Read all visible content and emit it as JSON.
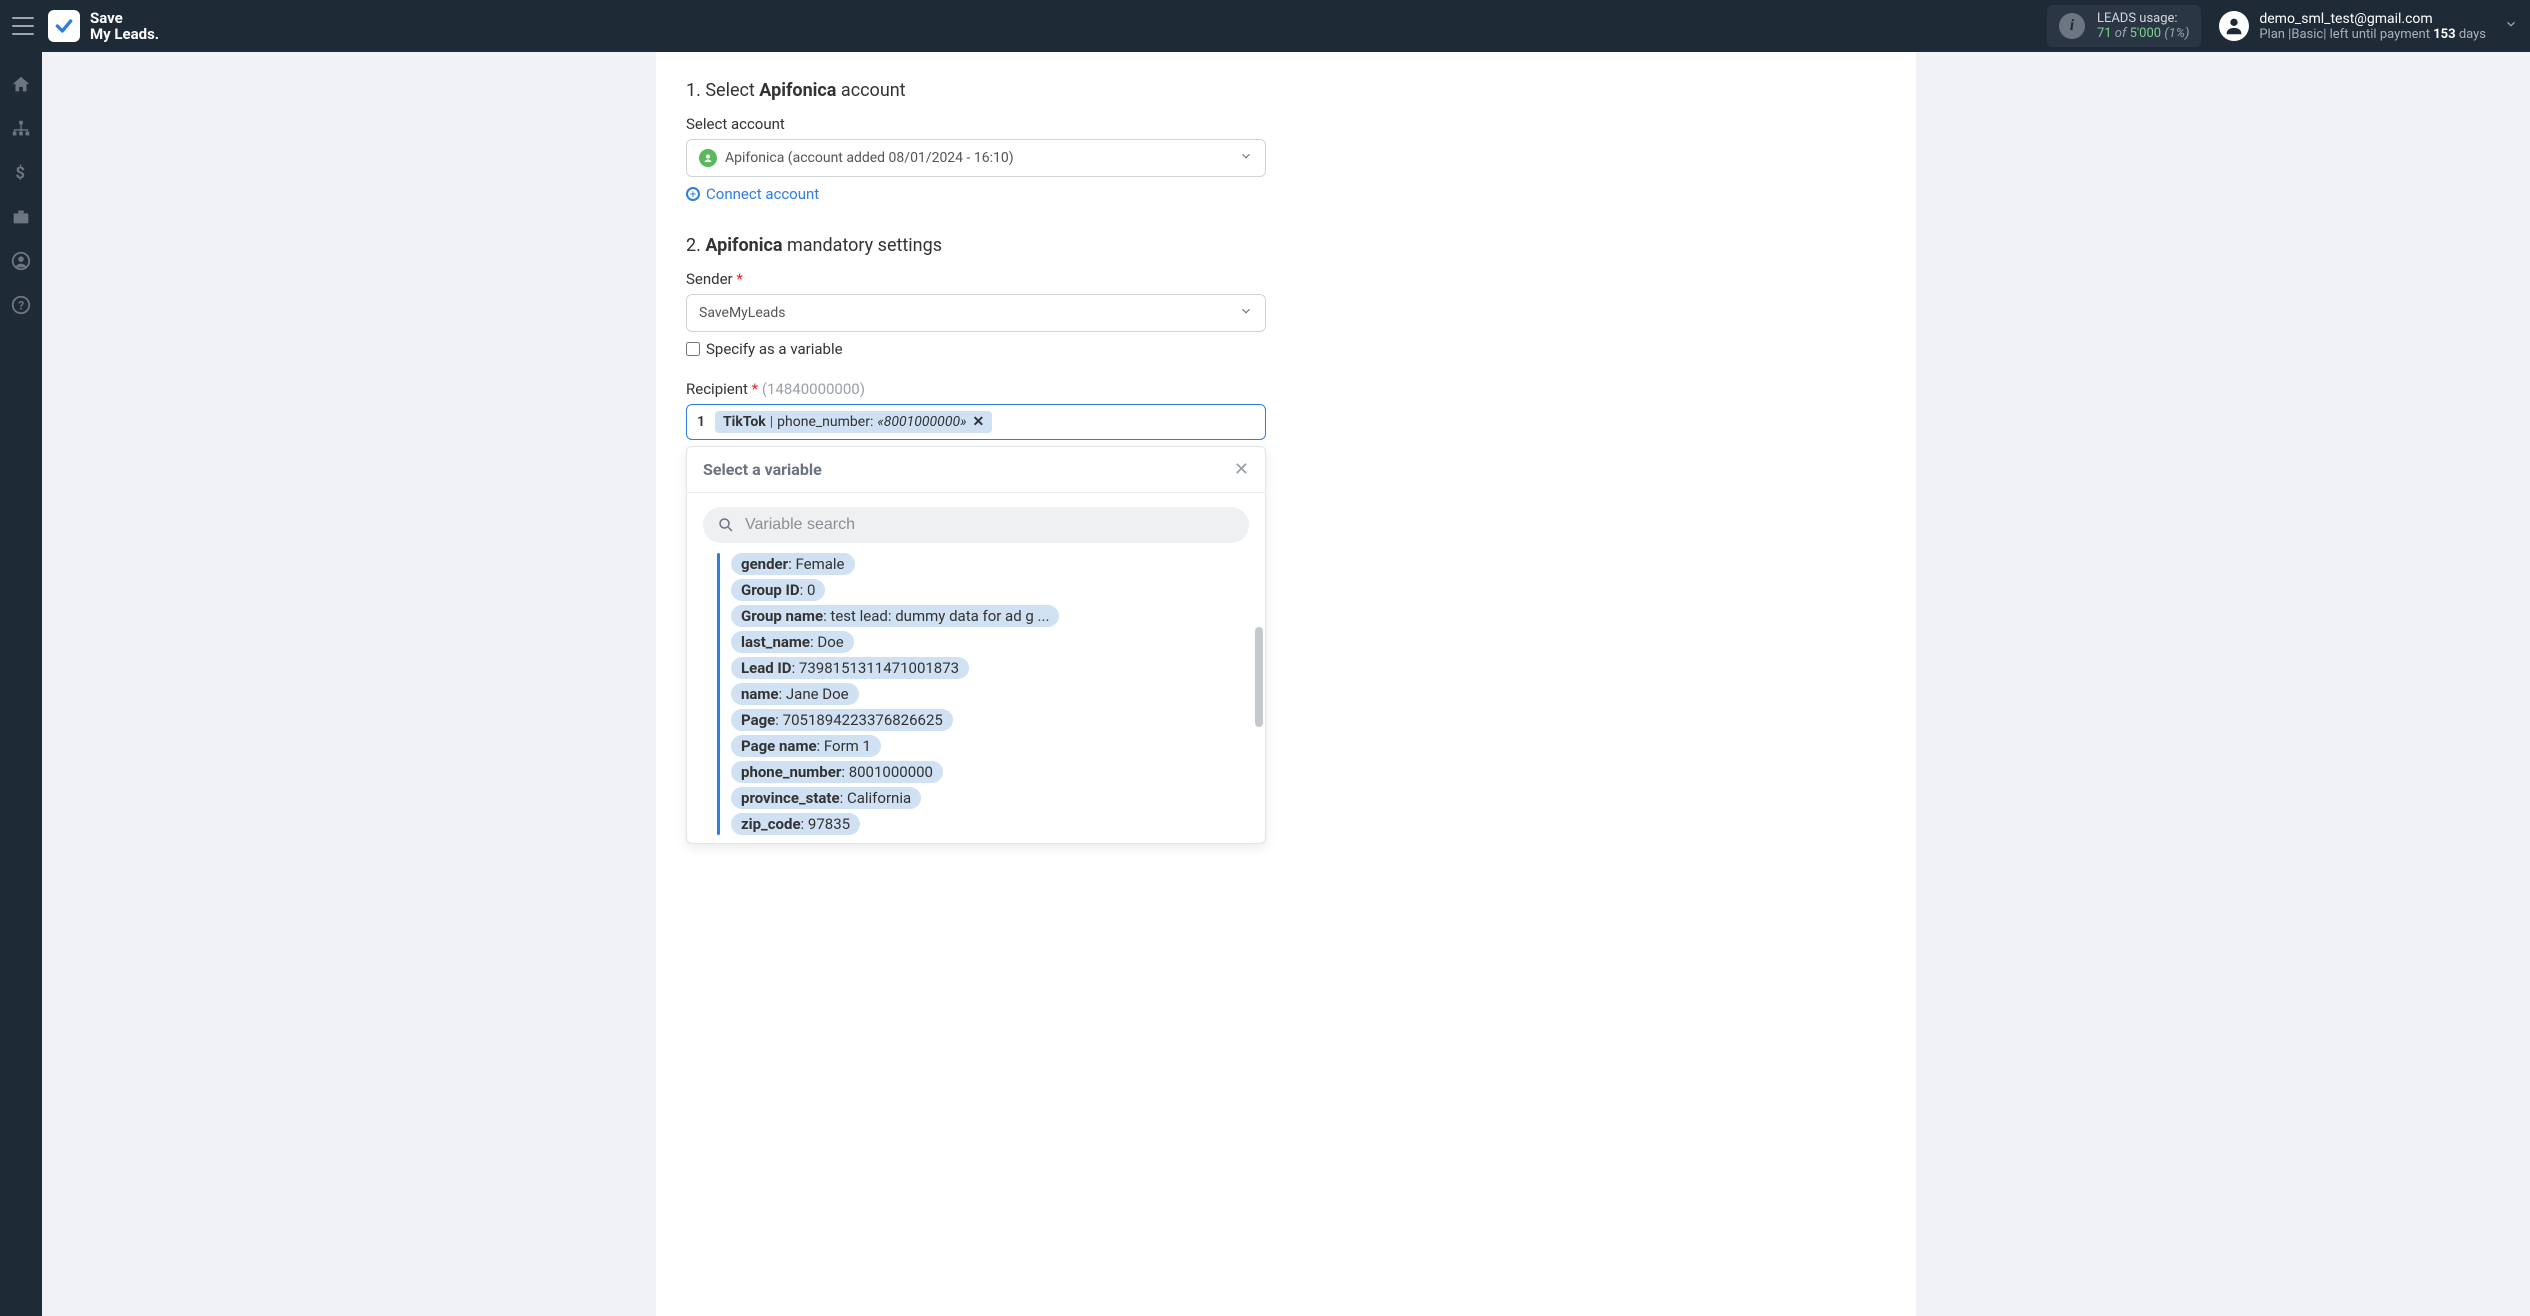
{
  "brand": {
    "line1": "Save",
    "line2": "My Leads."
  },
  "usage": {
    "label": "LEADS usage:",
    "count": "71",
    "of": "of",
    "limit": "5'000",
    "percent": "(1%)"
  },
  "user": {
    "email": "demo_sml_test@gmail.com",
    "plan_prefix": "Plan |",
    "plan_name": "Basic",
    "plan_mid": "| left until payment ",
    "plan_days": "153",
    "plan_suffix": " days"
  },
  "step1": {
    "num": "1.",
    "text_select": "Select ",
    "bold": "Apifonica",
    "text_acct": " account",
    "label": "Select account",
    "selected": "Apifonica (account added 08/01/2024 - 16:10)",
    "connect": "Connect account"
  },
  "step2": {
    "num": "2.",
    "bold": "Apifonica",
    "text": " mandatory settings",
    "sender_label": "Sender",
    "sender_value": "SaveMyLeads",
    "chk_label": "Specify as a variable",
    "recipient_label": "Recipient",
    "recipient_hint": "(14840000000)",
    "chip_count": "1",
    "chip": {
      "src": "TikTok",
      "pipe": " | ",
      "field": "phone_number: ",
      "val": "«8001000000»"
    }
  },
  "dropdown": {
    "title": "Select a variable",
    "search_placeholder": "Variable search",
    "variables": [
      {
        "k": "gender",
        "v": "Female"
      },
      {
        "k": "Group ID",
        "v": "0"
      },
      {
        "k": "Group name",
        "v": "test lead: dummy data for ad g ..."
      },
      {
        "k": "last_name",
        "v": "Doe"
      },
      {
        "k": "Lead ID",
        "v": "7398151311471001873"
      },
      {
        "k": "name",
        "v": "Jane Doe"
      },
      {
        "k": "Page",
        "v": "7051894223376826625"
      },
      {
        "k": "Page name",
        "v": "Form 1"
      },
      {
        "k": "phone_number",
        "v": "8001000000"
      },
      {
        "k": "province_state",
        "v": "California"
      },
      {
        "k": "zip_code",
        "v": "97835"
      }
    ]
  }
}
